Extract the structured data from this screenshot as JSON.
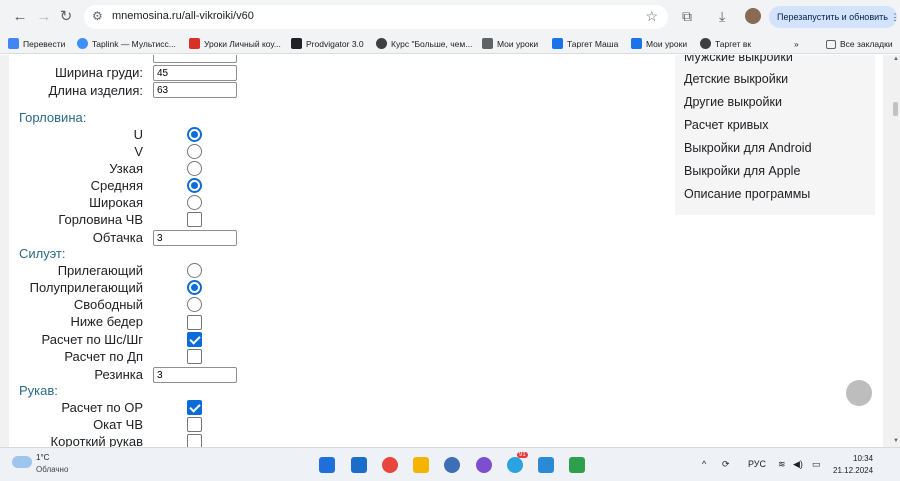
{
  "browser": {
    "url": "mnemosina.ru/all-vikroiki/v60",
    "update_button": "Перезапустить и обновить"
  },
  "bookmarks": [
    {
      "label": "Перевести",
      "color": "#4285f4"
    },
    {
      "label": "Taplink — Мультисс...",
      "color": "#3e8ef7"
    },
    {
      "label": "Уроки Личный коу...",
      "color": "#d93025"
    },
    {
      "label": "Prodvigator 3.0",
      "color": "#202124"
    },
    {
      "label": "Курс \"Больше, чем...",
      "color": "#3c4043"
    },
    {
      "label": "Мои уроки",
      "color": "#5f6368"
    },
    {
      "label": "Таргет Маша",
      "color": "#1a73e8"
    },
    {
      "label": "Мои уроки",
      "color": "#1a73e8"
    },
    {
      "label": "Таргет вк",
      "color": "#3c4043"
    }
  ],
  "bookmarks_all": "Все закладки",
  "form": {
    "chest_width_label": "Ширина груди:",
    "chest_width_value": "45",
    "length_label": "Длина изделия:",
    "length_value": "63",
    "neckline_title": "Горловина:",
    "neckline_u": "U",
    "neckline_v": "V",
    "neckline_narrow": "Узкая",
    "neckline_medium": "Средняя",
    "neckline_wide": "Широкая",
    "neckline_ch": "Горловина ЧВ",
    "facing_label": "Обтачка",
    "facing_value": "3",
    "silhouette_title": "Силуэт:",
    "fitted": "Прилегающий",
    "semi_fitted": "Полуприлегающий",
    "loose": "Свободный",
    "below_hips": "Ниже бедер",
    "calc_shs": "Расчет по Шс/Шг",
    "calc_dp": "Расчет по Дп",
    "elastic_label": "Резинка",
    "elastic_value": "3",
    "sleeve_title": "Рукав:",
    "calc_or": "Расчет по ОР",
    "okat_ch": "Окат ЧВ",
    "short_sleeve": "Короткий рукав"
  },
  "sidebar": {
    "items": [
      "Мужские выкройки",
      "Детские выкройки",
      "Другие выкройки",
      "Расчет кривых",
      "Выкройки для Android",
      "Выкройки для Apple",
      "Описание программы"
    ]
  },
  "taskbar": {
    "temp": "1°C",
    "weather": "Облачно",
    "lang": "РУС",
    "time": "10:34",
    "date": "21.12.2024",
    "telegram_badge": "91"
  }
}
